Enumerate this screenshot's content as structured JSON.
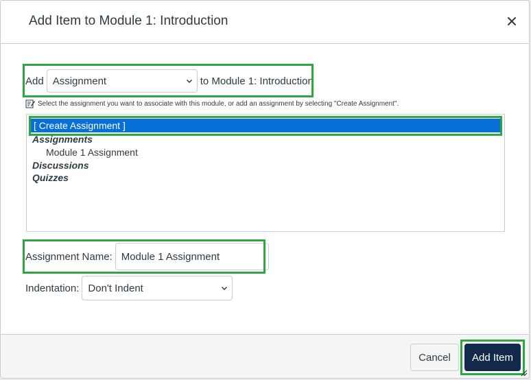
{
  "dialog": {
    "title": "Add Item to Module 1: Introduction",
    "close_icon": "close-icon"
  },
  "add_row": {
    "label": "Add",
    "type_selected": "Assignment",
    "suffix": "to Module 1: Introduction"
  },
  "hint": {
    "icon": "edit-note-icon",
    "text": "Select the assignment you want to associate with this module, or add an assignment by selecting \"Create Assignment\"."
  },
  "listbox": {
    "create_option": "[ Create Assignment ]",
    "groups": [
      {
        "label": "Assignments",
        "items": [
          "Module 1 Assignment"
        ]
      },
      {
        "label": "Discussions",
        "items": []
      },
      {
        "label": "Quizzes",
        "items": []
      }
    ]
  },
  "assignment_name": {
    "label": "Assignment Name:",
    "value": "Module 1 Assignment"
  },
  "indentation": {
    "label": "Indentation:",
    "selected": "Don't Indent"
  },
  "footer": {
    "cancel_label": "Cancel",
    "add_label": "Add Item"
  },
  "colors": {
    "highlight": "#2da73f",
    "selected_option": "#0770d8",
    "primary_button": "#13294b"
  }
}
